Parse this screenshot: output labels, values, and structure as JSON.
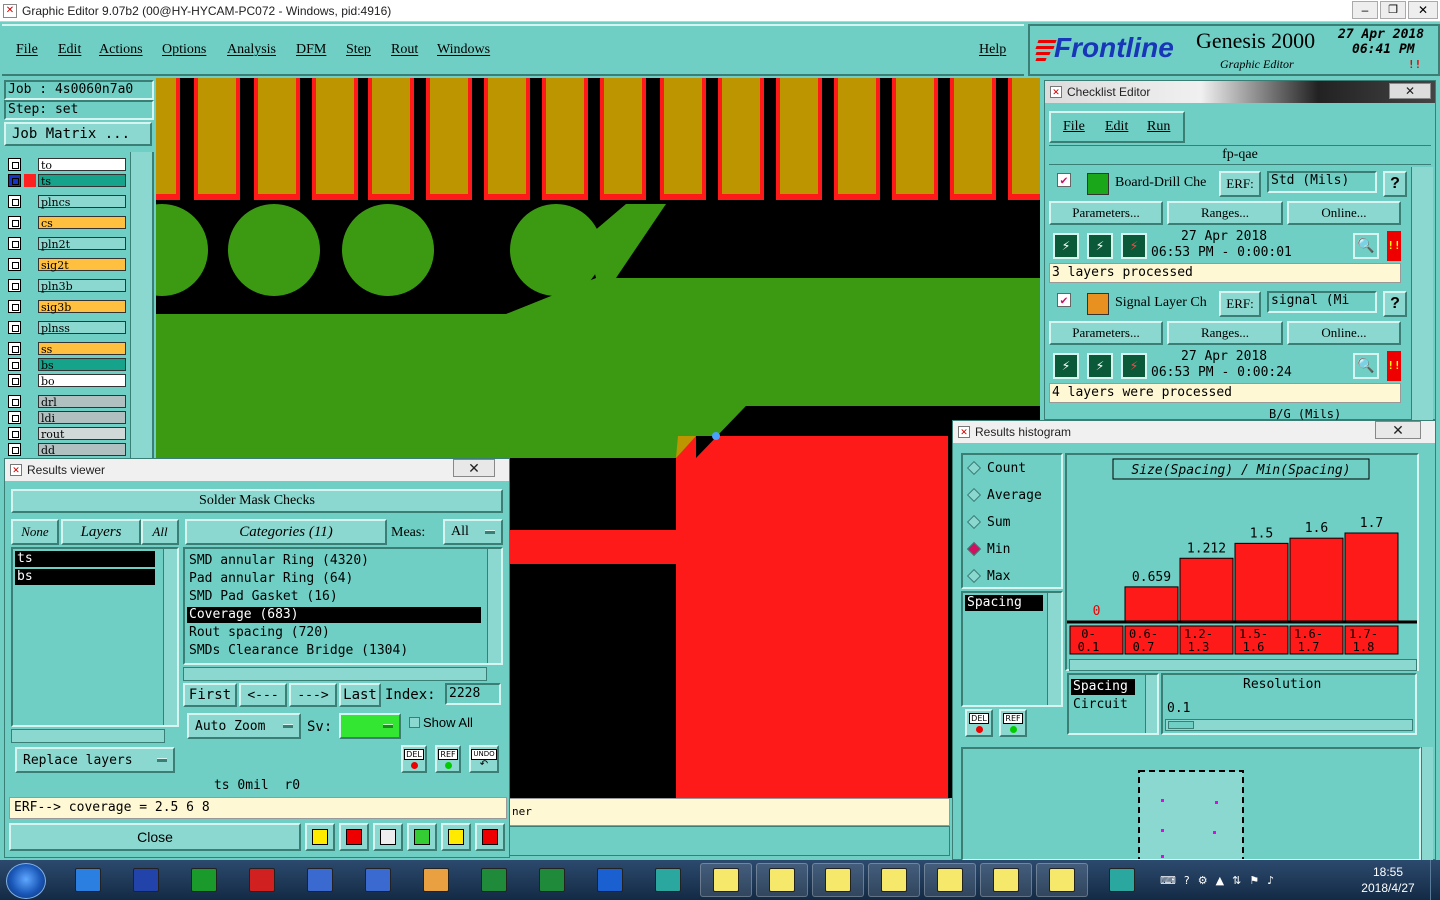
{
  "window": {
    "title": "Graphic Editor 9.07b2 (00@HY-HYCAM-PC072 - Windows, pid:4916)"
  },
  "menu": {
    "items": [
      "File",
      "Edit",
      "Actions",
      "Options",
      "Analysis",
      "DFM",
      "Step",
      "Rout",
      "Windows"
    ],
    "help": "Help"
  },
  "brand": {
    "logo": "Frontline",
    "product": "Genesis 2000",
    "subtitle": "Graphic Editor",
    "date": "27 Apr 2018",
    "time": "06:41 PM"
  },
  "job": {
    "job_label": "Job : 4s0060n7a0",
    "step_label": "Step: set",
    "matrix_button": "Job Matrix ..."
  },
  "layers": [
    {
      "name": "to",
      "bg": "#ffffff",
      "color": ""
    },
    {
      "name": "ts",
      "bg": "#15a38c",
      "color": "#ff2020"
    },
    {
      "name": "plncs",
      "bg": "#8ad8cf",
      "color": ""
    },
    {
      "name": "cs",
      "bg": "#ffc040",
      "color": ""
    },
    {
      "name": "pln2t",
      "bg": "#8ad8cf",
      "color": ""
    },
    {
      "name": "sig2t",
      "bg": "#ffc040",
      "color": ""
    },
    {
      "name": "pln3b",
      "bg": "#8ad8cf",
      "color": ""
    },
    {
      "name": "sig3b",
      "bg": "#ffc040",
      "color": ""
    },
    {
      "name": "plnss",
      "bg": "#8ad8cf",
      "color": ""
    },
    {
      "name": "ss",
      "bg": "#ffc040",
      "color": ""
    },
    {
      "name": "bs",
      "bg": "#15a38c",
      "color": ""
    },
    {
      "name": "bo",
      "bg": "#ffffff",
      "color": ""
    },
    {
      "name": "drl",
      "bg": "#b0c0c0",
      "color": ""
    },
    {
      "name": "ldi",
      "bg": "#b0c0c0",
      "color": ""
    },
    {
      "name": "rout",
      "bg": "#d0d8d8",
      "color": ""
    },
    {
      "name": "dd",
      "bg": "#b0c0c0",
      "color": ""
    }
  ],
  "checklist": {
    "title": "Checklist Editor",
    "menu": [
      "File",
      "Edit",
      "Run"
    ],
    "name": "fp-qae",
    "items": [
      {
        "name": "Board-Drill Che",
        "erf_label": "ERF:",
        "erf_value": "Std (Mils)",
        "parameters": "Parameters...",
        "ranges": "Ranges...",
        "online": "Online...",
        "date": "27 Apr 2018",
        "time": "06:53 PM - 0:00:01",
        "status": "3 layers processed"
      },
      {
        "name": "Signal Layer Ch",
        "erf_label": "ERF:",
        "erf_value": "signal (Mi",
        "parameters": "Parameters...",
        "ranges": "Ranges...",
        "online": "Online...",
        "date": "27 Apr 2018",
        "time": "06:53 PM - 0:00:24",
        "status": "4 layers were processed"
      }
    ],
    "partial_erf": "B/G (Mils)"
  },
  "results_viewer": {
    "title": "Results viewer",
    "header": "Solder Mask Checks",
    "none_btn": "None",
    "layers_btn": "Layers",
    "all_btn": "All",
    "categories_btn": "Categories (11)",
    "meas_label": "Meas:",
    "meas_value": "All",
    "layer_items": [
      "ts",
      "bs"
    ],
    "categories": [
      "SMD annular Ring (4320)",
      "Pad annular Ring (64)",
      "SMD Pad Gasket (16)",
      "Coverage (683)",
      "Rout spacing (720)",
      "SMDs Clearance Bridge (1304)"
    ],
    "selected_category": 3,
    "first": "First",
    "prev": "<---",
    "next": "--->",
    "last": "Last",
    "index_label": "Index:",
    "index_value": "2228",
    "auto_zoom": "Auto Zoom",
    "sv_label": "Sv:",
    "show_all": "Show All",
    "replace_layers": "Replace layers",
    "del": "DEL",
    "ref": "REF",
    "undo": "UNDO",
    "info": "ts 0mil  r0",
    "erf_line": "ERF--> coverage = 2.5 6 8",
    "close": "Close"
  },
  "status_strip": "ner",
  "histogram": {
    "title": "Results histogram",
    "options": [
      "Count",
      "Average",
      "Sum",
      "Min",
      "Max"
    ],
    "selected_option": "Min",
    "list_item": "Spacing",
    "chart_title": "Size(Spacing) / Min(Spacing)",
    "del": "DEL",
    "ref": "REF",
    "sel_items": [
      "Spacing",
      "Circuit"
    ],
    "resolution_label": "Resolution",
    "resolution_value": "0.1"
  },
  "chart_data": {
    "type": "bar",
    "title": "Size(Spacing) / Min(Spacing)",
    "categories": [
      "0-0.1",
      "0.6-0.7",
      "1.2-1.3",
      "1.5-1.6",
      "1.6-1.7",
      "1.7-1.8"
    ],
    "bin_labels": [
      [
        "0-",
        "0.1"
      ],
      [
        "0.6-",
        "0.7"
      ],
      [
        "1.2-",
        "1.3"
      ],
      [
        "1.5-",
        "1.6"
      ],
      [
        "1.6-",
        "1.7"
      ],
      [
        "1.7-",
        "1.8"
      ]
    ],
    "values": [
      0,
      0.659,
      1.212,
      1.5,
      1.6,
      1.7
    ],
    "value_labels": [
      "0",
      "0.659",
      "1.212",
      "1.5",
      "1.6",
      "1.7"
    ],
    "ylim": [
      0,
      1.7
    ],
    "bar_color": "#ff1a1a",
    "grid": false
  },
  "taskbar": {
    "clock_time": "18:55",
    "clock_date": "2018/4/27"
  },
  "colors": {
    "bg": "#6fcfc4",
    "red": "#ff1a1a",
    "green": "#3c9a12",
    "gold": "#bd9500",
    "black": "#000000"
  }
}
